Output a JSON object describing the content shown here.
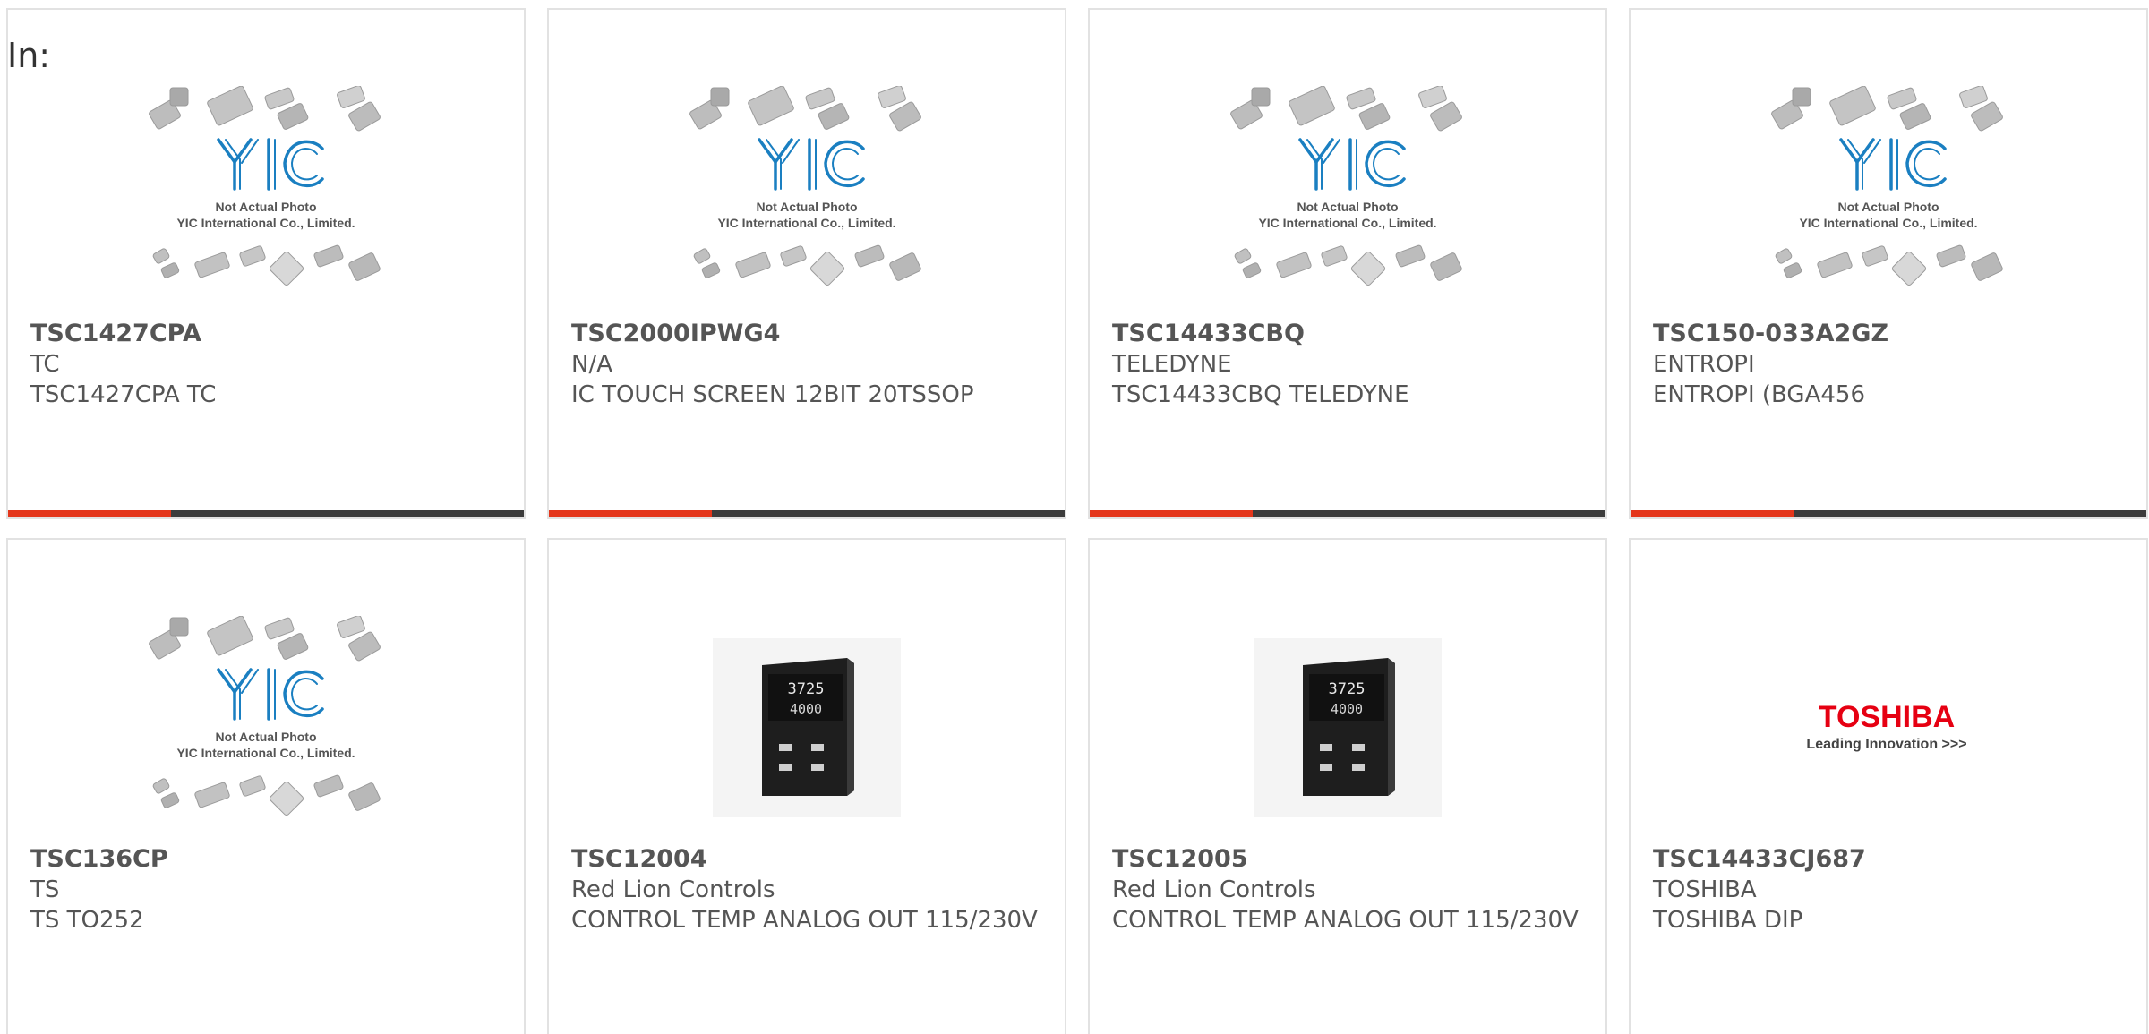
{
  "header": {
    "in_label": "In:"
  },
  "placeholder": {
    "logo_text": "YIC",
    "line1": "Not Actual Photo",
    "line2": "YIC International Co., Limited."
  },
  "controller_display": {
    "top": "3725",
    "bottom": "4000"
  },
  "toshiba_logo": {
    "brand": "TOSHIBA",
    "tagline": "Leading Innovation >>>"
  },
  "colors": {
    "accent": "#e4361b",
    "bar": "#3c3c3c",
    "text": "#555555",
    "yic_blue": "#1a7fc1",
    "toshiba_red": "#e60012"
  },
  "products": [
    {
      "part_number": "TSC1427CPA",
      "manufacturer": "TC",
      "description": "TSC1427CPA TC",
      "image": "yic-placeholder"
    },
    {
      "part_number": "TSC2000IPWG4",
      "manufacturer": "N/A",
      "description": "IC TOUCH SCREEN 12BIT 20TSSOP",
      "image": "yic-placeholder"
    },
    {
      "part_number": "TSC14433CBQ",
      "manufacturer": "TELEDYNE",
      "description": "TSC14433CBQ TELEDYNE",
      "image": "yic-placeholder"
    },
    {
      "part_number": "TSC150-033A2GZ",
      "manufacturer": "ENTROPI",
      "description": "ENTROPI (BGA456",
      "image": "yic-placeholder"
    },
    {
      "part_number": "TSC136CP",
      "manufacturer": "TS",
      "description": "TS TO252",
      "image": "yic-placeholder"
    },
    {
      "part_number": "TSC12004",
      "manufacturer": "Red Lion Controls",
      "description": "CONTROL TEMP ANALOG OUT 115/230V",
      "image": "controller"
    },
    {
      "part_number": "TSC12005",
      "manufacturer": "Red Lion Controls",
      "description": "CONTROL TEMP ANALOG OUT 115/230V",
      "image": "controller"
    },
    {
      "part_number": "TSC14433CJ687",
      "manufacturer": "TOSHIBA",
      "description": "TOSHIBA DIP",
      "image": "toshiba-logo"
    }
  ]
}
